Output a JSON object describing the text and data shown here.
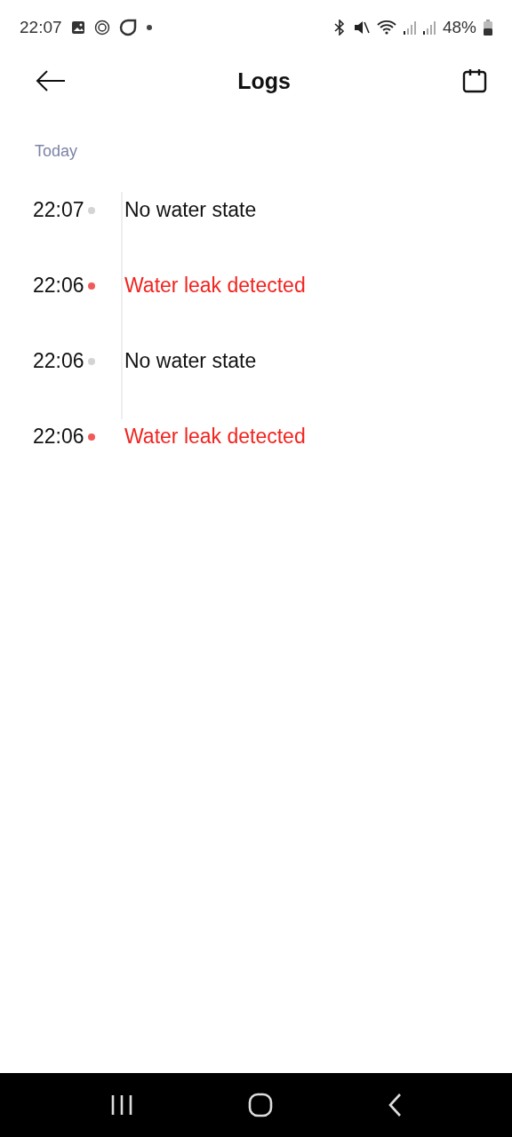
{
  "status_bar": {
    "time": "22:07",
    "battery": "48%"
  },
  "header": {
    "title": "Logs"
  },
  "section": "Today",
  "logs": [
    {
      "time": "22:07",
      "event": "No water state",
      "kind": "normal"
    },
    {
      "time": "22:06",
      "event": "Water leak detected",
      "kind": "alert"
    },
    {
      "time": "22:06",
      "event": "No water state",
      "kind": "normal"
    },
    {
      "time": "22:06",
      "event": "Water leak detected",
      "kind": "alert"
    }
  ]
}
